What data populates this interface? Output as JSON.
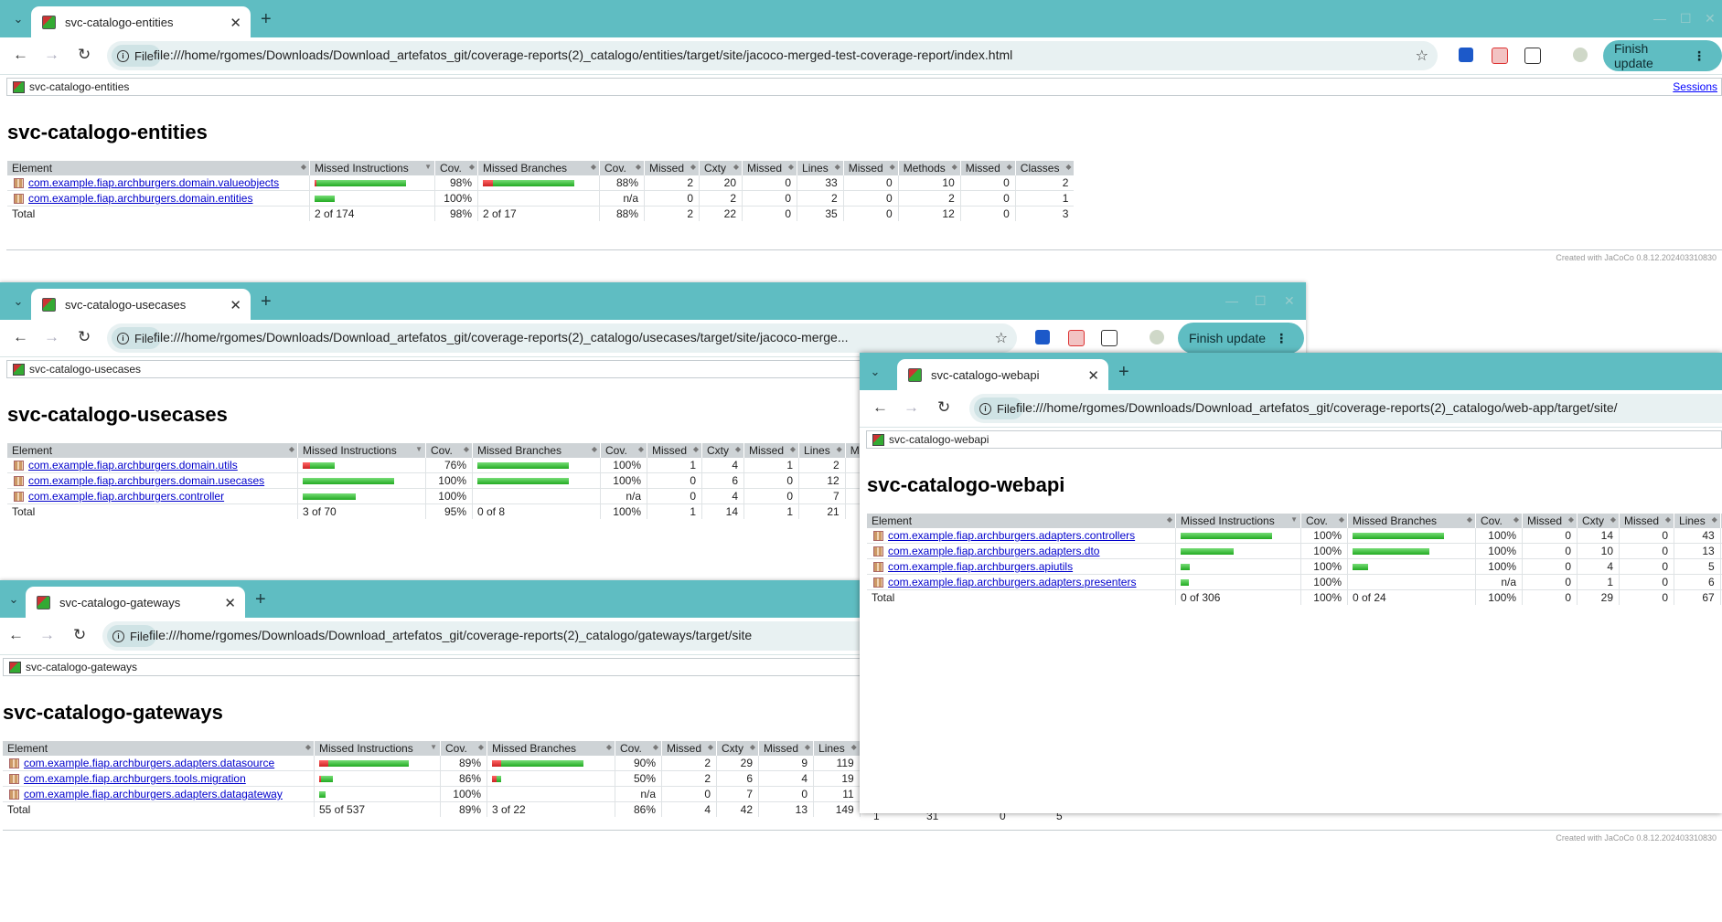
{
  "browser": {
    "finish_update": "Finish update",
    "file_chip": "File"
  },
  "footer_text": "Created with JaCoCo 0.8.12.202403310830",
  "entities": {
    "tab_title": "svc-catalogo-entities",
    "url": "file:///home/rgomes/Downloads/Download_artefatos_git/coverage-reports(2)_catalogo/entities/target/site/jacoco-merged-test-coverage-report/index.html",
    "breadcrumb": "svc-catalogo-entities",
    "sessions": "Sessions",
    "heading": "svc-catalogo-entities",
    "headers": [
      "Element",
      "Missed Instructions",
      "Cov.",
      "Missed Branches",
      "Cov.",
      "Missed",
      "Cxty",
      "Missed",
      "Lines",
      "Missed",
      "Methods",
      "Missed",
      "Classes"
    ],
    "rows": [
      {
        "name": "com.example.fiap.archburgers.domain.valueobjects",
        "icov": "98%",
        "bcov": "88%",
        "c": [
          "2",
          "20",
          "0",
          "33",
          "0",
          "10",
          "0",
          "2"
        ],
        "ir": 2,
        "ig": 98,
        "br": 11,
        "bg": 89
      },
      {
        "name": "com.example.fiap.archburgers.domain.entities",
        "icov": "100%",
        "bcov": "n/a",
        "c": [
          "0",
          "2",
          "0",
          "2",
          "0",
          "2",
          "0",
          "1"
        ],
        "ir": 0,
        "ig": 22,
        "br": 0,
        "bg": 0
      }
    ],
    "total": {
      "label": "Total",
      "mi": "2 of 174",
      "icov": "98%",
      "mb": "2 of 17",
      "bcov": "88%",
      "c": [
        "2",
        "22",
        "0",
        "35",
        "0",
        "12",
        "0",
        "3"
      ]
    }
  },
  "usecases": {
    "tab_title": "svc-catalogo-usecases",
    "url": "file:///home/rgomes/Downloads/Download_artefatos_git/coverage-reports(2)_catalogo/usecases/target/site/jacoco-merge...",
    "breadcrumb": "svc-catalogo-usecases",
    "heading": "svc-catalogo-usecases",
    "headers": [
      "Element",
      "Missed Instructions",
      "Cov.",
      "Missed Branches",
      "Cov.",
      "Missed",
      "Cxty",
      "Missed",
      "Lines",
      "Missed"
    ],
    "rows": [
      {
        "name": "com.example.fiap.archburgers.domain.utils",
        "icov": "76%",
        "bcov": "100%",
        "c": [
          "1",
          "4",
          "1",
          "2"
        ],
        "ir": 8,
        "ig": 27,
        "br": 0,
        "bg": 100
      },
      {
        "name": "com.example.fiap.archburgers.domain.usecases",
        "icov": "100%",
        "bcov": "100%",
        "c": [
          "0",
          "6",
          "0",
          "12"
        ],
        "ir": 0,
        "ig": 100,
        "br": 0,
        "bg": 100
      },
      {
        "name": "com.example.fiap.archburgers.controller",
        "icov": "100%",
        "bcov": "n/a",
        "c": [
          "0",
          "4",
          "0",
          "7"
        ],
        "ir": 0,
        "ig": 58,
        "br": 0,
        "bg": 0
      }
    ],
    "total": {
      "label": "Total",
      "mi": "3 of 70",
      "icov": "95%",
      "mb": "0 of 8",
      "bcov": "100%",
      "c": [
        "1",
        "14",
        "1",
        "21"
      ]
    }
  },
  "gateways": {
    "tab_title": "svc-catalogo-gateways",
    "url": "file:///home/rgomes/Downloads/Download_artefatos_git/coverage-reports(2)_catalogo/gateways/target/site",
    "breadcrumb": "svc-catalogo-gateways",
    "heading": "svc-catalogo-gateways",
    "headers": [
      "Element",
      "Missed Instructions",
      "Cov.",
      "Missed Branches",
      "Cov.",
      "Missed",
      "Cxty",
      "Missed",
      "Lines",
      "M"
    ],
    "rows": [
      {
        "name": "com.example.fiap.archburgers.adapters.datasource",
        "icov": "89%",
        "bcov": "90%",
        "c": [
          "2",
          "29",
          "9",
          "119"
        ],
        "ir": 10,
        "ig": 88,
        "br": 10,
        "bg": 90
      },
      {
        "name": "com.example.fiap.archburgers.tools.migration",
        "icov": "86%",
        "bcov": "50%",
        "c": [
          "2",
          "6",
          "4",
          "19"
        ],
        "ir": 2,
        "ig": 13,
        "br": 5,
        "bg": 5
      },
      {
        "name": "com.example.fiap.archburgers.adapters.datagateway",
        "icov": "100%",
        "bcov": "n/a",
        "c": [
          "0",
          "7",
          "0",
          "11"
        ],
        "ir": 0,
        "ig": 7,
        "br": 0,
        "bg": 0
      }
    ],
    "total": {
      "label": "Total",
      "mi": "55 of 537",
      "icov": "89%",
      "mb": "3 of 22",
      "bcov": "86%",
      "c": [
        "4",
        "42",
        "13",
        "149"
      ]
    },
    "extra_total": [
      "1",
      "31",
      "0",
      "5"
    ]
  },
  "webapi": {
    "tab_title": "svc-catalogo-webapi",
    "url": "file:///home/rgomes/Downloads/Download_artefatos_git/coverage-reports(2)_catalogo/web-app/target/site/",
    "breadcrumb": "svc-catalogo-webapi",
    "heading": "svc-catalogo-webapi",
    "headers": [
      "Element",
      "Missed Instructions",
      "Cov.",
      "Missed Branches",
      "Cov.",
      "Missed",
      "Cxty",
      "Missed",
      "Lines",
      "M"
    ],
    "rows": [
      {
        "name": "com.example.fiap.archburgers.adapters.controllers",
        "icov": "100%",
        "bcov": "100%",
        "c": [
          "0",
          "14",
          "0",
          "43"
        ],
        "ir": 0,
        "ig": 100,
        "br": 0,
        "bg": 100
      },
      {
        "name": "com.example.fiap.archburgers.adapters.dto",
        "icov": "100%",
        "bcov": "100%",
        "c": [
          "0",
          "10",
          "0",
          "13"
        ],
        "ir": 0,
        "ig": 58,
        "br": 0,
        "bg": 84
      },
      {
        "name": "com.example.fiap.archburgers.apiutils",
        "icov": "100%",
        "bcov": "100%",
        "c": [
          "0",
          "4",
          "0",
          "5"
        ],
        "ir": 0,
        "ig": 10,
        "br": 0,
        "bg": 17
      },
      {
        "name": "com.example.fiap.archburgers.adapters.presenters",
        "icov": "100%",
        "bcov": "n/a",
        "c": [
          "0",
          "1",
          "0",
          "6"
        ],
        "ir": 0,
        "ig": 9,
        "br": 0,
        "bg": 0
      }
    ],
    "total": {
      "label": "Total",
      "mi": "0 of 306",
      "icov": "100%",
      "mb": "0 of 24",
      "bcov": "100%",
      "c": [
        "0",
        "29",
        "0",
        "67"
      ]
    }
  }
}
